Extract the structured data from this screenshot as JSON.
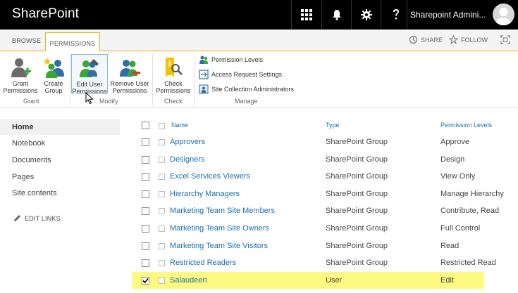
{
  "suite": {
    "brand": "SharePoint",
    "user_name": "Sharepoint Admini..."
  },
  "ribbon": {
    "tabs": [
      "BROWSE",
      "PERMISSIONS"
    ],
    "share_label": "SHARE",
    "follow_label": "FOLLOW",
    "buttons": {
      "grant": "Grant Permissions",
      "create": "Create Group",
      "edit": "Edit User Permissions",
      "remove": "Remove User Permissions",
      "check": "Check Permissions"
    },
    "manage_links": [
      "Permission Levels",
      "Access Request Settings",
      "Site Collection Administrators"
    ],
    "groups": [
      "Grant",
      "Modify",
      "Check",
      "Manage"
    ]
  },
  "nav": {
    "items": [
      "Home",
      "Notebook",
      "Documents",
      "Pages",
      "Site contents"
    ],
    "edit_links": "EDIT LINKS"
  },
  "table": {
    "headers": {
      "name": "Name",
      "type": "Type",
      "perm": "Permission Levels"
    },
    "rows": [
      {
        "name": "Approvers",
        "type": "SharePoint Group",
        "perm": "Approve",
        "checked": false
      },
      {
        "name": "Designers",
        "type": "SharePoint Group",
        "perm": "Design",
        "checked": false
      },
      {
        "name": "Excel Services Viewers",
        "type": "SharePoint Group",
        "perm": "View Only",
        "checked": false
      },
      {
        "name": "Hierarchy Managers",
        "type": "SharePoint Group",
        "perm": "Manage Hierarchy",
        "checked": false
      },
      {
        "name": "Marketing Team Site Members",
        "type": "SharePoint Group",
        "perm": "Contribute, Read",
        "checked": false
      },
      {
        "name": "Marketing Team Site Owners",
        "type": "SharePoint Group",
        "perm": "Full Control",
        "checked": false
      },
      {
        "name": "Marketing Team Site Visitors",
        "type": "SharePoint Group",
        "perm": "Read",
        "checked": false
      },
      {
        "name": "Restricted Readers",
        "type": "SharePoint Group",
        "perm": "Restricted Read",
        "checked": false
      },
      {
        "name": "Salaudeen",
        "type": "User",
        "perm": "Edit",
        "checked": true
      }
    ]
  },
  "colors": {
    "accent": "#f0a818",
    "link": "#1a6fb0",
    "highlight": "#fcfa80"
  }
}
